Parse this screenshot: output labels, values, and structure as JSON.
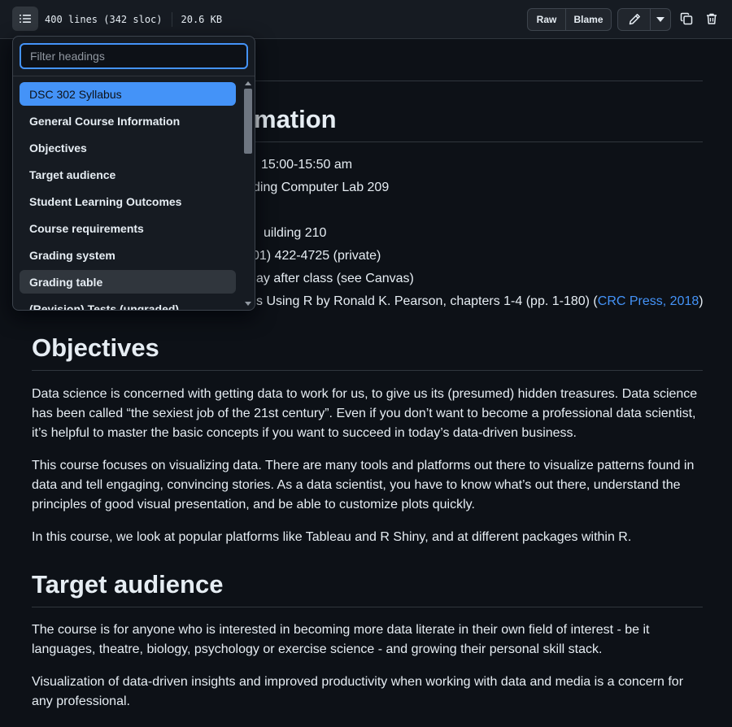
{
  "toolbar": {
    "lines": "400 lines (342 sloc)",
    "size": "20.6 KB",
    "raw_label": "Raw",
    "blame_label": "Blame",
    "icons": [
      "list-outline-icon",
      "pencil-icon",
      "triangle-down-icon",
      "copy-icon",
      "trash-icon"
    ]
  },
  "outline": {
    "placeholder": "Filter headings",
    "items": [
      {
        "label": "DSC 302 Syllabus"
      },
      {
        "label": "General Course Information"
      },
      {
        "label": "Objectives"
      },
      {
        "label": "Target audience"
      },
      {
        "label": "Student Learning Outcomes"
      },
      {
        "label": "Course requirements"
      },
      {
        "label": "Grading system"
      },
      {
        "label": "Grading table"
      },
      {
        "label": "(Revision) Tests (ungraded)"
      }
    ]
  },
  "content": {
    "general_heading_visible": "ormation",
    "info_lines": [
      "15:00-15:50 am",
      "ding Computer Lab 209",
      "uilding 210",
      "01) 422-4725 (private)",
      "ay after class (see Canvas)",
      "s Using R by Ronald K. Pearson, chapters 1-4 (pp. 1-180) ("
    ],
    "book_link": "CRC Press, 2018",
    "book_close": ")",
    "objectives_heading": "Objectives",
    "objectives_p1": "Data science is concerned with getting data to work for us, to give us its (presumed) hidden treasures. Data science has been called “the sexiest job of the 21st century”. Even if you don’t want to become a professional data scientist, it’s helpful to master the basic concepts if you want to succeed in today’s data-driven business.",
    "objectives_p2": "This course focuses on visualizing data. There are many tools and platforms out there to visualize patterns found in data and tell engaging, convincing stories. As a data scientist, you have to know what’s out there, understand the principles of good visual presentation, and be able to customize plots quickly.",
    "objectives_p3": "In this course, we look at popular platforms like Tableau and R Shiny, and at different packages within R.",
    "audience_heading": "Target audience",
    "audience_p1": "The course is for anyone who is interested in becoming more data literate in their own field of interest - be it languages, theatre, biology, psychology or exercise science - and growing their personal skill stack.",
    "audience_p2": "Visualization of data-driven insights and improved productivity when working with data and media is a concern for any professional."
  },
  "colors": {
    "background": "#0d1117",
    "accent": "#4493f8",
    "border": "#30363d"
  }
}
